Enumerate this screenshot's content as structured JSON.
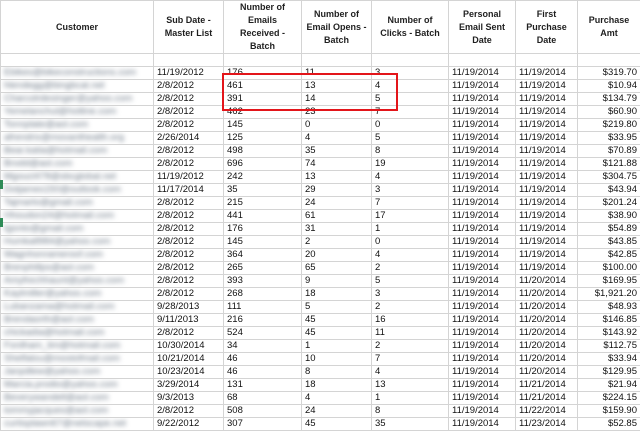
{
  "columns": [
    "Customer",
    "Sub Date - Master List",
    "Number of Emails Received - Batch",
    "Number of Email Opens - Batch",
    "Number of Clicks - Batch",
    "Personal Email Sent Date",
    "First Purchase Date",
    "Purchase Amt"
  ],
  "rows": [
    {
      "customer": "",
      "sub_date": "",
      "received": "",
      "opens": "",
      "clicks": "",
      "sent": "",
      "first": "",
      "amt": ""
    },
    {
      "customer": "Ebikes@bikeconstructions.com",
      "sub_date": "11/19/2012",
      "received": "176",
      "opens": "11",
      "clicks": "3",
      "sent": "11/19/2014",
      "first": "11/19/2014",
      "amt": "$319.70"
    },
    {
      "customer": "hlendegg@bingbcat.net",
      "sub_date": "2/8/2012",
      "received": "461",
      "opens": "13",
      "clicks": "4",
      "sent": "11/19/2014",
      "first": "11/19/2014",
      "amt": "$10.94"
    },
    {
      "customer": "Charcolrdesinger@yahoo.com",
      "sub_date": "2/8/2012",
      "received": "391",
      "opens": "14",
      "clicks": "5",
      "sent": "11/19/2014",
      "first": "11/19/2014",
      "amt": "$134.79"
    },
    {
      "customer": "Yemelanchul@hotline.com",
      "sub_date": "2/8/2012",
      "received": "462",
      "opens": "23",
      "clicks": "7",
      "sent": "11/19/2014",
      "first": "11/19/2014",
      "amt": "$60.90"
    },
    {
      "customer": "Tonnplate@aol.com",
      "sub_date": "2/8/2012",
      "received": "145",
      "opens": "0",
      "clicks": "0",
      "sent": "11/19/2014",
      "first": "11/19/2014",
      "amt": "$219.80"
    },
    {
      "customer": "afrendrix@movanthealth.org",
      "sub_date": "2/26/2014",
      "received": "125",
      "opens": "4",
      "clicks": "5",
      "sent": "11/19/2014",
      "first": "11/19/2014",
      "amt": "$33.95"
    },
    {
      "customer": "Bear.katia@hotmail.com",
      "sub_date": "2/8/2012",
      "received": "498",
      "opens": "35",
      "clicks": "8",
      "sent": "11/19/2014",
      "first": "11/19/2014",
      "amt": "$70.89"
    },
    {
      "customer": "Brodd@aol.com",
      "sub_date": "2/8/2012",
      "received": "696",
      "opens": "74",
      "clicks": "19",
      "sent": "11/19/2014",
      "first": "11/19/2014",
      "amt": "$121.88"
    },
    {
      "customer": "Mgoucl478@sbcglobal.net",
      "sub_date": "11/19/2012",
      "received": "242",
      "opens": "13",
      "clicks": "4",
      "sent": "11/19/2014",
      "first": "11/19/2014",
      "amt": "$304.75"
    },
    {
      "customer": "Dotjames150@outlook.com",
      "sub_date": "11/17/2014",
      "received": "35",
      "opens": "29",
      "clicks": "3",
      "sent": "11/19/2014",
      "first": "11/19/2014",
      "amt": "$43.94"
    },
    {
      "customer": "Tajmarlo@gmail.com",
      "sub_date": "2/8/2012",
      "received": "215",
      "opens": "24",
      "clicks": "7",
      "sent": "11/19/2014",
      "first": "11/19/2014",
      "amt": "$201.24"
    },
    {
      "customer": "Hhoudon24@hotmail.com",
      "sub_date": "2/8/2012",
      "received": "441",
      "opens": "61",
      "clicks": "17",
      "sent": "11/19/2014",
      "first": "11/19/2014",
      "amt": "$38.90"
    },
    {
      "customer": "tgonto@gmail.com",
      "sub_date": "2/8/2012",
      "received": "176",
      "opens": "31",
      "clicks": "1",
      "sent": "11/19/2014",
      "first": "11/19/2014",
      "amt": "$54.89"
    },
    {
      "customer": "Humkall984@yahoo.com",
      "sub_date": "2/8/2012",
      "received": "145",
      "opens": "2",
      "clicks": "0",
      "sent": "11/19/2014",
      "first": "11/19/2014",
      "amt": "$43.85"
    },
    {
      "customer": "Wagnhonrameroof.com",
      "sub_date": "2/8/2012",
      "received": "364",
      "opens": "20",
      "clicks": "4",
      "sent": "11/19/2014",
      "first": "11/19/2014",
      "amt": "$42.85"
    },
    {
      "customer": "Brenphillps@aol.com",
      "sub_date": "2/8/2012",
      "received": "265",
      "opens": "65",
      "clicks": "2",
      "sent": "11/19/2014",
      "first": "11/19/2014",
      "amt": "$100.00"
    },
    {
      "customer": "Amyfrechhaunt@yahoo.com",
      "sub_date": "2/8/2012",
      "received": "393",
      "opens": "9",
      "clicks": "5",
      "sent": "11/19/2014",
      "first": "11/20/2014",
      "amt": "$169.95"
    },
    {
      "customer": "Kaylmiller@yahoo.com",
      "sub_date": "2/8/2012",
      "received": "268",
      "opens": "18",
      "clicks": "3",
      "sent": "11/19/2014",
      "first": "11/20/2014",
      "amt": "$1,921.20"
    },
    {
      "customer": "Lubanzama@hotmail.com",
      "sub_date": "9/28/2013",
      "received": "111",
      "opens": "5",
      "clicks": "2",
      "sent": "11/19/2014",
      "first": "11/20/2014",
      "amt": "$48.93"
    },
    {
      "customer": "Brendaorth@aol.com",
      "sub_date": "9/11/2013",
      "received": "216",
      "opens": "45",
      "clicks": "16",
      "sent": "11/19/2014",
      "first": "11/20/2014",
      "amt": "$146.85"
    },
    {
      "customer": "chickadia@hotmail.com",
      "sub_date": "2/8/2012",
      "received": "524",
      "opens": "45",
      "clicks": "11",
      "sent": "11/19/2014",
      "first": "11/20/2014",
      "amt": "$143.92"
    },
    {
      "customer": "Fordham_lim@hotmail.com",
      "sub_date": "10/30/2014",
      "received": "34",
      "opens": "1",
      "clicks": "2",
      "sent": "11/19/2014",
      "first": "11/20/2014",
      "amt": "$112.75"
    },
    {
      "customer": "Shelfalou@mostofmail.com",
      "sub_date": "10/21/2014",
      "received": "46",
      "opens": "10",
      "clicks": "7",
      "sent": "11/19/2014",
      "first": "11/20/2014",
      "amt": "$33.94"
    },
    {
      "customer": "Janpdlew@yahoo.com",
      "sub_date": "10/23/2014",
      "received": "46",
      "opens": "8",
      "clicks": "4",
      "sent": "11/19/2014",
      "first": "11/20/2014",
      "amt": "$129.95"
    },
    {
      "customer": "Marcia.prodio@yahoo.com",
      "sub_date": "3/29/2014",
      "received": "131",
      "opens": "18",
      "clicks": "13",
      "sent": "11/19/2014",
      "first": "11/21/2014",
      "amt": "$21.94"
    },
    {
      "customer": "Beverywandell@aol.com",
      "sub_date": "9/3/2013",
      "received": "68",
      "opens": "4",
      "clicks": "1",
      "sent": "11/19/2014",
      "first": "11/21/2014",
      "amt": "$224.15"
    },
    {
      "customer": "tommyjacques@aol.com",
      "sub_date": "2/8/2012",
      "received": "508",
      "opens": "24",
      "clicks": "8",
      "sent": "11/19/2014",
      "first": "11/22/2014",
      "amt": "$159.90"
    },
    {
      "customer": "curtisplawn67@netscape.net",
      "sub_date": "9/22/2012",
      "received": "307",
      "opens": "45",
      "clicks": "35",
      "sent": "11/19/2014",
      "first": "11/23/2014",
      "amt": "$52.85"
    }
  ],
  "highlight_color": "#e3151a",
  "grid_color": "#d4d4d4"
}
